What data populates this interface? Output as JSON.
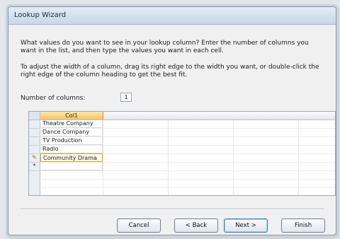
{
  "window": {
    "title": "Lookup Wizard"
  },
  "instructions": {
    "line1": "What values do you want to see in your lookup column? Enter the number of columns you want in the list, and then type the values you want in each cell.",
    "line2": "To adjust the width of a column, drag its right edge to the width you want, or double-click the right edge of the column heading to get the best fit."
  },
  "columns_field": {
    "label": "Number of columns:",
    "value": "1"
  },
  "grid": {
    "column_header": "Col1",
    "rows": [
      "Theatre Company",
      "Dance Company",
      "TV Production",
      "Radio",
      "Community Drama"
    ],
    "new_row_marker": "*"
  },
  "buttons": {
    "cancel": "Cancel",
    "back": "< Back",
    "next": "Next >",
    "finish": "Finish"
  },
  "icons": {
    "editing_row": "pencil-icon",
    "new_row": "asterisk-icon"
  }
}
